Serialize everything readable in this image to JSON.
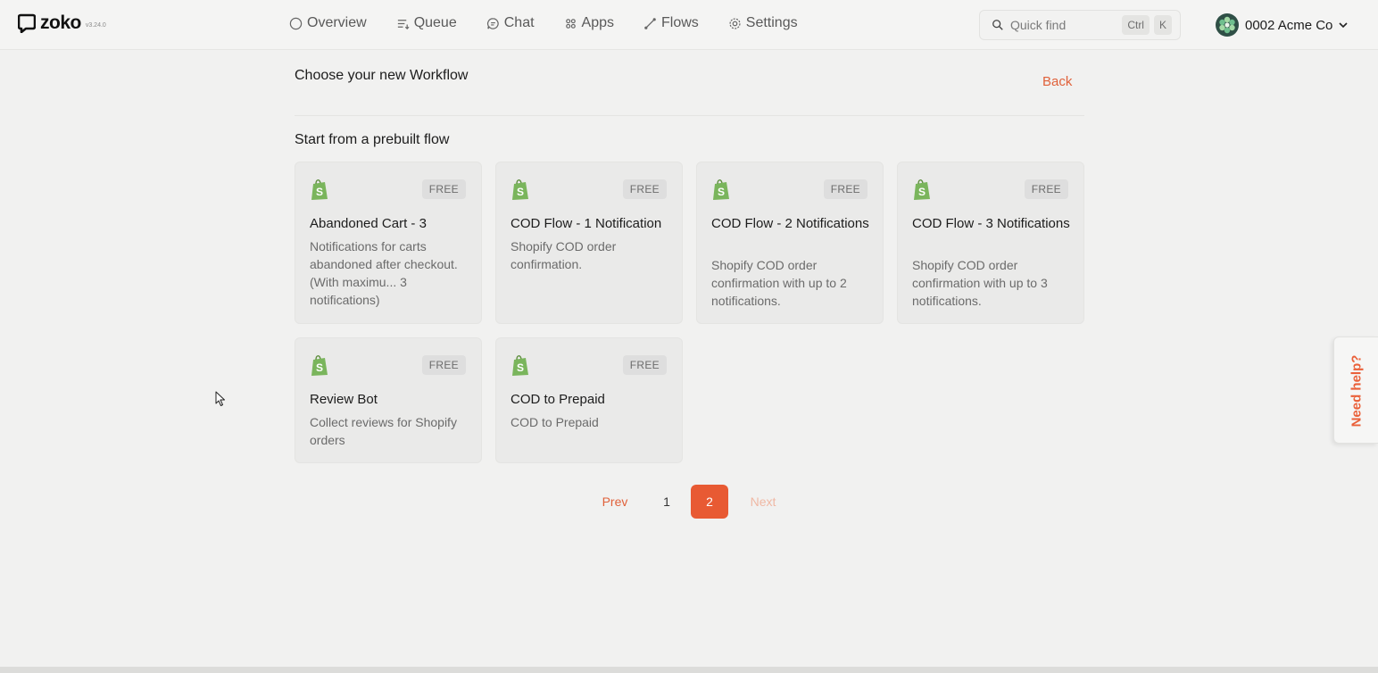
{
  "app": {
    "logo_text": "zoko",
    "version": "v3.24.0"
  },
  "nav": {
    "items": [
      {
        "label": "Overview",
        "icon": "circle-icon"
      },
      {
        "label": "Queue",
        "icon": "queue-icon"
      },
      {
        "label": "Chat",
        "icon": "chat-icon"
      },
      {
        "label": "Apps",
        "icon": "apps-icon"
      },
      {
        "label": "Flows",
        "icon": "flows-icon"
      },
      {
        "label": "Settings",
        "icon": "gear-icon"
      }
    ]
  },
  "search": {
    "placeholder": "Quick find",
    "shortcut_ctrl": "Ctrl",
    "shortcut_key": "K"
  },
  "account": {
    "name": "0002 Acme Co"
  },
  "page": {
    "title": "Choose your new Workflow",
    "back_label": "Back",
    "section_title": "Start from a prebuilt flow"
  },
  "cards": [
    {
      "icon": "shopify-bag-icon",
      "badge": "FREE",
      "title": "Abandoned Cart - 3",
      "description": "Notifications for carts abandoned after checkout. (With maximu... 3 notifications)"
    },
    {
      "icon": "shopify-bag-icon",
      "badge": "FREE",
      "title": "COD Flow - 1 Notification",
      "description": "Shopify COD order confirmation."
    },
    {
      "icon": "shopify-bag-icon",
      "badge": "FREE",
      "title": "COD Flow - 2 Notifications",
      "description": "Shopify COD order confirmation with up to 2 notifications."
    },
    {
      "icon": "shopify-bag-icon",
      "badge": "FREE",
      "title": "COD Flow - 3 Notifications",
      "description": "Shopify COD order confirmation with up to 3 notifications."
    },
    {
      "icon": "shopify-bag-icon",
      "badge": "FREE",
      "title": "Review Bot",
      "description": "Collect reviews for Shopify orders"
    },
    {
      "icon": "shopify-bag-icon",
      "badge": "FREE",
      "title": "COD to Prepaid",
      "description": "COD to Prepaid"
    }
  ],
  "pagination": {
    "prev_label": "Prev",
    "pages": [
      "1",
      "2"
    ],
    "current_page": "2",
    "next_label": "Next"
  },
  "help": {
    "label": "Need help?"
  },
  "colors": {
    "accent": "#e85a33",
    "shopify_green": "#7ab55c",
    "background": "#f1f1f0"
  }
}
